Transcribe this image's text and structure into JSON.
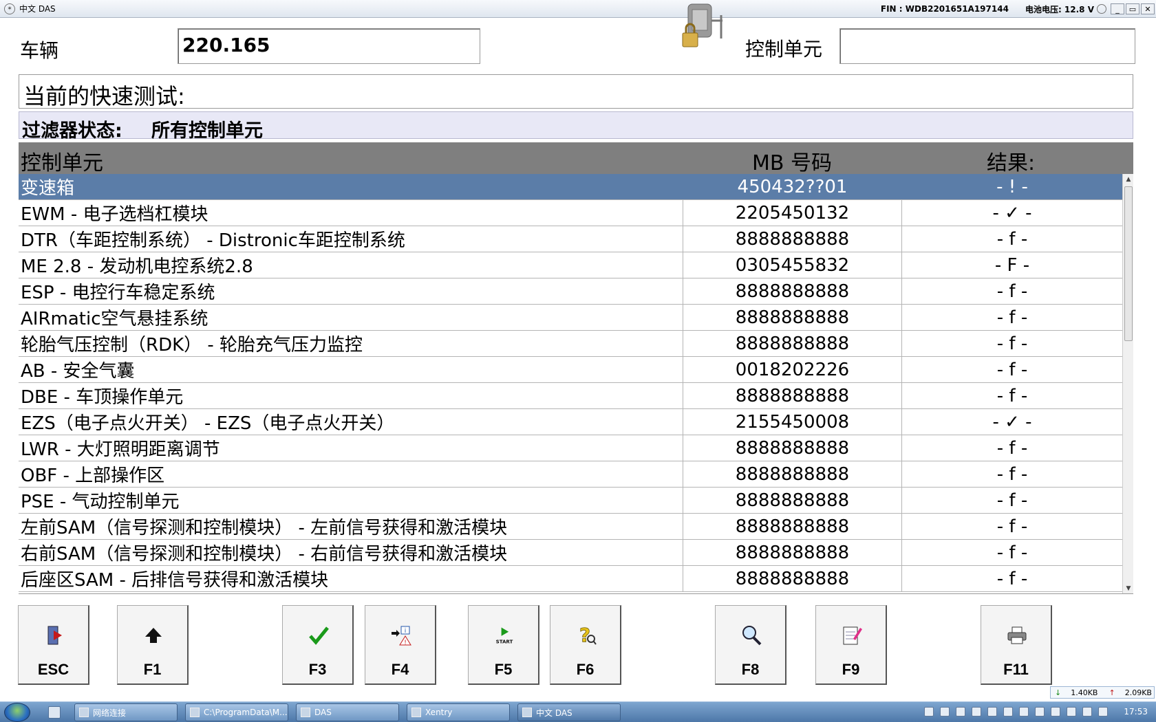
{
  "window": {
    "title": "中文 DAS",
    "fin": "FIN : WDB2201651A197144",
    "battery": "电池电压: 12.8 V",
    "buttons": [
      "_",
      "▭",
      "✕"
    ]
  },
  "header": {
    "vehicle_label": "车辆",
    "vehicle_value": "220.165",
    "control_unit_label": "控制单元",
    "control_unit_value": ""
  },
  "quicktest_label": "当前的快速测试:",
  "filter": {
    "label": "过滤器状态:",
    "value": "所有控制单元"
  },
  "table": {
    "headers": {
      "unit": "控制单元",
      "mb": "MB 号码",
      "result": "结果:"
    },
    "rows": [
      {
        "unit": "变速箱",
        "mb": "450432??01",
        "result": "- ! -",
        "selected": true
      },
      {
        "unit": "EWM - 电子选档杠模块",
        "mb": "2205450132",
        "result": "- ✓ -"
      },
      {
        "unit": "DTR（车距控制系统） - Distronic车距控制系统",
        "mb": "8888888888",
        "result": "- f -"
      },
      {
        "unit": "ME 2.8 - 发动机电控系统2.8",
        "mb": "0305455832",
        "result": "- F -"
      },
      {
        "unit": "ESP - 电控行车稳定系统",
        "mb": "8888888888",
        "result": "- f -"
      },
      {
        "unit": "AIRmatic空气悬挂系统",
        "mb": "8888888888",
        "result": "- f -"
      },
      {
        "unit": "轮胎气压控制（RDK） - 轮胎充气压力监控",
        "mb": "8888888888",
        "result": "- f -"
      },
      {
        "unit": "AB - 安全气囊",
        "mb": "0018202226",
        "result": "- f -"
      },
      {
        "unit": "DBE - 车顶操作单元",
        "mb": "8888888888",
        "result": "- f -"
      },
      {
        "unit": "EZS（电子点火开关） - EZS（电子点火开关）",
        "mb": "2155450008",
        "result": "- ✓ -"
      },
      {
        "unit": "LWR - 大灯照明距离调节",
        "mb": "8888888888",
        "result": "- f -"
      },
      {
        "unit": "OBF - 上部操作区",
        "mb": "8888888888",
        "result": "- f -"
      },
      {
        "unit": "PSE - 气动控制单元",
        "mb": "8888888888",
        "result": "- f -"
      },
      {
        "unit": "左前SAM（信号探测和控制模块） - 左前信号获得和激活模块",
        "mb": "8888888888",
        "result": "- f -"
      },
      {
        "unit": "右前SAM（信号探测和控制模块） - 右前信号获得和激活模块",
        "mb": "8888888888",
        "result": "- f -"
      },
      {
        "unit": "后座区SAM - 后排信号获得和激活模块",
        "mb": "8888888888",
        "result": "- f -"
      }
    ]
  },
  "fkeys": [
    {
      "label": "ESC",
      "icon": "exit-door-icon"
    },
    {
      "label": "F1",
      "icon": "up-arrow-icon"
    },
    {
      "label": "F3",
      "icon": "checkmark-icon"
    },
    {
      "label": "F4",
      "icon": "info-warning-icon"
    },
    {
      "label": "F5",
      "icon": "start-icon",
      "icon_text": "START"
    },
    {
      "label": "F6",
      "icon": "help-icon"
    },
    {
      "label": "F8",
      "icon": "magnifier-icon"
    },
    {
      "label": "F9",
      "icon": "notepad-icon"
    },
    {
      "label": "F11",
      "icon": "printer-icon"
    }
  ],
  "netstat": {
    "down": "1.40KB",
    "up": "2.09KB"
  },
  "taskbar": {
    "items": [
      {
        "label": "网络连接"
      },
      {
        "label": "C:\\ProgramData\\M..."
      },
      {
        "label": "DAS"
      },
      {
        "label": "Xentry"
      },
      {
        "label": "中文 DAS",
        "active": true
      }
    ],
    "clock": "17:53"
  },
  "colors": {
    "selected_row": "#5b7da8",
    "header_bg": "#7f7f7f",
    "filter_bg": "#e8e8f6",
    "check_green": "#1a9a1a"
  }
}
